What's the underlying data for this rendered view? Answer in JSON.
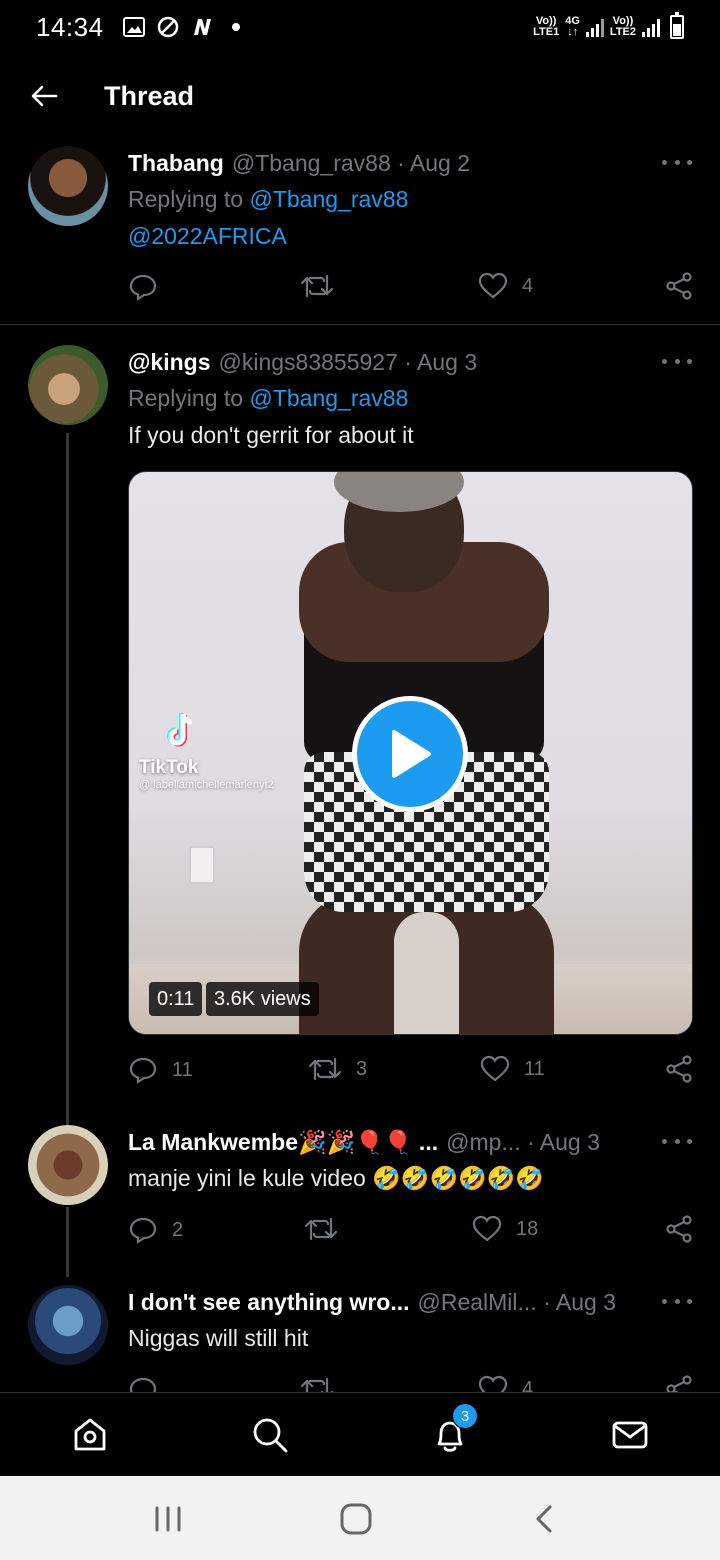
{
  "status_bar": {
    "time": "14:34",
    "left_icons": [
      "gallery-icon",
      "blocked-icon",
      "n-app-icon",
      "dot-icon"
    ],
    "net1_top": "Vo))",
    "net1_bottom": "LTE1",
    "net_type": "4G",
    "net2_top": "Vo))",
    "net2_bottom": "LTE2"
  },
  "header": {
    "title": "Thread"
  },
  "tweets": [
    {
      "name": "Thabang",
      "meta": "@Tbang_rav88 · Aug 2",
      "replying_prefix": "Replying to ",
      "replying_to": "@Tbang_rav88",
      "text": "@2022AFRICA",
      "replies": "",
      "retweets": "",
      "likes": "4"
    },
    {
      "name": "@kings",
      "meta": "@kings83855927 · Aug 3",
      "replying_prefix": "Replying to ",
      "replying_to": "@Tbang_rav88",
      "text": "If you don't gerrit for about it",
      "media": {
        "tiktok_label": "TikTok",
        "tiktok_handle": "@ labellamichellemarlenyt2",
        "duration": "0:11",
        "views": "3.6K views"
      },
      "replies": "11",
      "retweets": "3",
      "likes": "11"
    },
    {
      "name": "La Mankwembe🎉🎉🎈🎈 ...",
      "meta": "@mp... · Aug 3",
      "text": "manje yini le kule video 🤣🤣🤣🤣🤣🤣",
      "replies": "2",
      "retweets": "",
      "likes": "18"
    },
    {
      "name": "I don't see anything wro...",
      "meta": "@RealMil... · Aug 3",
      "text": "Niggas will still hit",
      "replies": "",
      "retweets": "",
      "likes": "4"
    }
  ],
  "bottom_nav": {
    "items": [
      "home-icon",
      "search-icon",
      "notifications-icon",
      "messages-icon"
    ],
    "notification_count": "3"
  },
  "colors": {
    "accent": "#1d9bf0",
    "muted": "#71767b",
    "background": "#000000"
  }
}
